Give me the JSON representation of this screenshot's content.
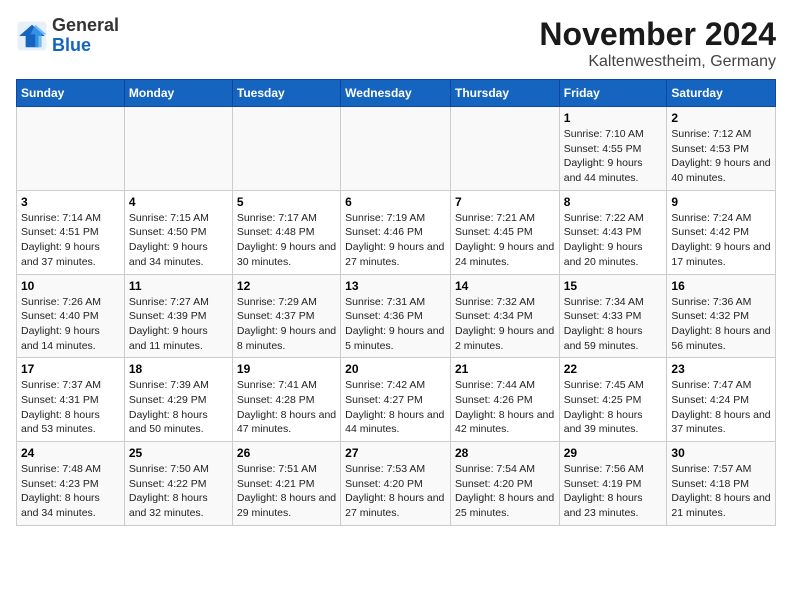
{
  "logo": {
    "general": "General",
    "blue": "Blue"
  },
  "title": "November 2024",
  "subtitle": "Kaltenwestheim, Germany",
  "days_header": [
    "Sunday",
    "Monday",
    "Tuesday",
    "Wednesday",
    "Thursday",
    "Friday",
    "Saturday"
  ],
  "weeks": [
    [
      {
        "day": "",
        "info": ""
      },
      {
        "day": "",
        "info": ""
      },
      {
        "day": "",
        "info": ""
      },
      {
        "day": "",
        "info": ""
      },
      {
        "day": "",
        "info": ""
      },
      {
        "day": "1",
        "info": "Sunrise: 7:10 AM\nSunset: 4:55 PM\nDaylight: 9 hours and 44 minutes."
      },
      {
        "day": "2",
        "info": "Sunrise: 7:12 AM\nSunset: 4:53 PM\nDaylight: 9 hours and 40 minutes."
      }
    ],
    [
      {
        "day": "3",
        "info": "Sunrise: 7:14 AM\nSunset: 4:51 PM\nDaylight: 9 hours and 37 minutes."
      },
      {
        "day": "4",
        "info": "Sunrise: 7:15 AM\nSunset: 4:50 PM\nDaylight: 9 hours and 34 minutes."
      },
      {
        "day": "5",
        "info": "Sunrise: 7:17 AM\nSunset: 4:48 PM\nDaylight: 9 hours and 30 minutes."
      },
      {
        "day": "6",
        "info": "Sunrise: 7:19 AM\nSunset: 4:46 PM\nDaylight: 9 hours and 27 minutes."
      },
      {
        "day": "7",
        "info": "Sunrise: 7:21 AM\nSunset: 4:45 PM\nDaylight: 9 hours and 24 minutes."
      },
      {
        "day": "8",
        "info": "Sunrise: 7:22 AM\nSunset: 4:43 PM\nDaylight: 9 hours and 20 minutes."
      },
      {
        "day": "9",
        "info": "Sunrise: 7:24 AM\nSunset: 4:42 PM\nDaylight: 9 hours and 17 minutes."
      }
    ],
    [
      {
        "day": "10",
        "info": "Sunrise: 7:26 AM\nSunset: 4:40 PM\nDaylight: 9 hours and 14 minutes."
      },
      {
        "day": "11",
        "info": "Sunrise: 7:27 AM\nSunset: 4:39 PM\nDaylight: 9 hours and 11 minutes."
      },
      {
        "day": "12",
        "info": "Sunrise: 7:29 AM\nSunset: 4:37 PM\nDaylight: 9 hours and 8 minutes."
      },
      {
        "day": "13",
        "info": "Sunrise: 7:31 AM\nSunset: 4:36 PM\nDaylight: 9 hours and 5 minutes."
      },
      {
        "day": "14",
        "info": "Sunrise: 7:32 AM\nSunset: 4:34 PM\nDaylight: 9 hours and 2 minutes."
      },
      {
        "day": "15",
        "info": "Sunrise: 7:34 AM\nSunset: 4:33 PM\nDaylight: 8 hours and 59 minutes."
      },
      {
        "day": "16",
        "info": "Sunrise: 7:36 AM\nSunset: 4:32 PM\nDaylight: 8 hours and 56 minutes."
      }
    ],
    [
      {
        "day": "17",
        "info": "Sunrise: 7:37 AM\nSunset: 4:31 PM\nDaylight: 8 hours and 53 minutes."
      },
      {
        "day": "18",
        "info": "Sunrise: 7:39 AM\nSunset: 4:29 PM\nDaylight: 8 hours and 50 minutes."
      },
      {
        "day": "19",
        "info": "Sunrise: 7:41 AM\nSunset: 4:28 PM\nDaylight: 8 hours and 47 minutes."
      },
      {
        "day": "20",
        "info": "Sunrise: 7:42 AM\nSunset: 4:27 PM\nDaylight: 8 hours and 44 minutes."
      },
      {
        "day": "21",
        "info": "Sunrise: 7:44 AM\nSunset: 4:26 PM\nDaylight: 8 hours and 42 minutes."
      },
      {
        "day": "22",
        "info": "Sunrise: 7:45 AM\nSunset: 4:25 PM\nDaylight: 8 hours and 39 minutes."
      },
      {
        "day": "23",
        "info": "Sunrise: 7:47 AM\nSunset: 4:24 PM\nDaylight: 8 hours and 37 minutes."
      }
    ],
    [
      {
        "day": "24",
        "info": "Sunrise: 7:48 AM\nSunset: 4:23 PM\nDaylight: 8 hours and 34 minutes."
      },
      {
        "day": "25",
        "info": "Sunrise: 7:50 AM\nSunset: 4:22 PM\nDaylight: 8 hours and 32 minutes."
      },
      {
        "day": "26",
        "info": "Sunrise: 7:51 AM\nSunset: 4:21 PM\nDaylight: 8 hours and 29 minutes."
      },
      {
        "day": "27",
        "info": "Sunrise: 7:53 AM\nSunset: 4:20 PM\nDaylight: 8 hours and 27 minutes."
      },
      {
        "day": "28",
        "info": "Sunrise: 7:54 AM\nSunset: 4:20 PM\nDaylight: 8 hours and 25 minutes."
      },
      {
        "day": "29",
        "info": "Sunrise: 7:56 AM\nSunset: 4:19 PM\nDaylight: 8 hours and 23 minutes."
      },
      {
        "day": "30",
        "info": "Sunrise: 7:57 AM\nSunset: 4:18 PM\nDaylight: 8 hours and 21 minutes."
      }
    ]
  ]
}
